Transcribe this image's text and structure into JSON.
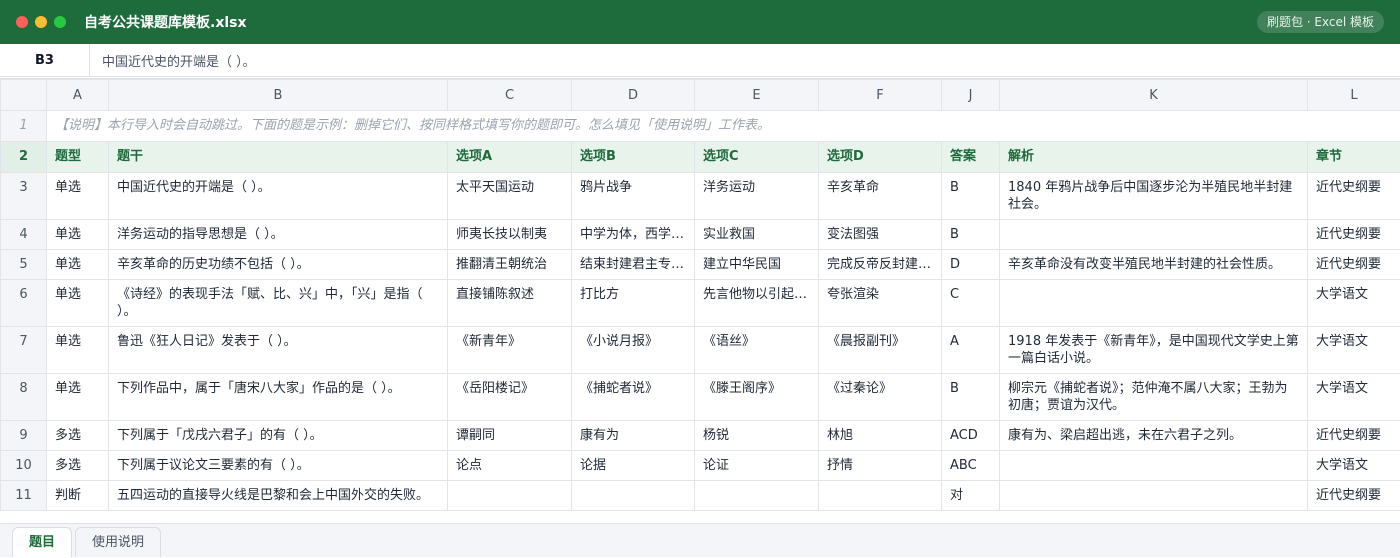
{
  "window": {
    "title": "自考公共课题库模板.xlsx",
    "badge": "刷题包 · Excel 模板"
  },
  "formula_bar": {
    "cell_ref": "B3",
    "value": "中国近代史的开端是（ ）。"
  },
  "columns": [
    "A",
    "B",
    "C",
    "D",
    "E",
    "F",
    "J",
    "K",
    "L"
  ],
  "note_row": {
    "num": "1",
    "text": "【说明】本行导入时会自动跳过。下面的题是示例：删掉它们、按同样格式填写你的题即可。怎么填见「使用说明」工作表。"
  },
  "header_row": {
    "num": "2",
    "cells": [
      "题型",
      "题干",
      "选项A",
      "选项B",
      "选项C",
      "选项D",
      "答案",
      "解析",
      "章节"
    ]
  },
  "rows": [
    {
      "num": "3",
      "cells": [
        "单选",
        "中国近代史的开端是（ ）。",
        "太平天国运动",
        "鸦片战争",
        "洋务运动",
        "辛亥革命",
        "B",
        "1840 年鸦片战争后中国逐步沦为半殖民地半封建社会。",
        "近代史纲要"
      ]
    },
    {
      "num": "4",
      "cells": [
        "单选",
        "洋务运动的指导思想是（ ）。",
        "师夷长技以制夷",
        "中学为体，西学为用",
        "实业救国",
        "变法图强",
        "B",
        "",
        "近代史纲要"
      ]
    },
    {
      "num": "5",
      "cells": [
        "单选",
        "辛亥革命的历史功绩不包括（ ）。",
        "推翻清王朝统治",
        "结束封建君主专制制度",
        "建立中华民国",
        "完成反帝反封建任务",
        "D",
        "辛亥革命没有改变半殖民地半封建的社会性质。",
        "近代史纲要"
      ]
    },
    {
      "num": "6",
      "cells": [
        "单选",
        "《诗经》的表现手法「赋、比、兴」中，「兴」是指（ ）。",
        "直接铺陈叙述",
        "打比方",
        "先言他物以引起所咏之词",
        "夸张渲染",
        "C",
        "",
        "大学语文"
      ]
    },
    {
      "num": "7",
      "cells": [
        "单选",
        "鲁迅《狂人日记》发表于（ ）。",
        "《新青年》",
        "《小说月报》",
        "《语丝》",
        "《晨报副刊》",
        "A",
        "1918 年发表于《新青年》，是中国现代文学史上第一篇白话小说。",
        "大学语文"
      ]
    },
    {
      "num": "8",
      "cells": [
        "单选",
        "下列作品中，属于「唐宋八大家」作品的是（ ）。",
        "《岳阳楼记》",
        "《捕蛇者说》",
        "《滕王阁序》",
        "《过秦论》",
        "B",
        "柳宗元《捕蛇者说》；范仲淹不属八大家；王勃为初唐；贾谊为汉代。",
        "大学语文"
      ]
    },
    {
      "num": "9",
      "cells": [
        "多选",
        "下列属于「戊戌六君子」的有（ ）。",
        "谭嗣同",
        "康有为",
        "杨锐",
        "林旭",
        "ACD",
        "康有为、梁启超出逃，未在六君子之列。",
        "近代史纲要"
      ]
    },
    {
      "num": "10",
      "cells": [
        "多选",
        "下列属于议论文三要素的有（ ）。",
        "论点",
        "论据",
        "论证",
        "抒情",
        "ABC",
        "",
        "大学语文"
      ]
    },
    {
      "num": "11",
      "cells": [
        "判断",
        "五四运动的直接导火线是巴黎和会上中国外交的失败。",
        "",
        "",
        "",
        "",
        "对",
        "",
        "近代史纲要"
      ]
    }
  ],
  "sheet_tabs": [
    {
      "label": "题目",
      "active": true
    },
    {
      "label": "使用说明",
      "active": false
    }
  ],
  "colors": {
    "brand": "#1e6b3c",
    "header_fill": "#e8f3ec",
    "grid_line": "#e1e5ea"
  }
}
